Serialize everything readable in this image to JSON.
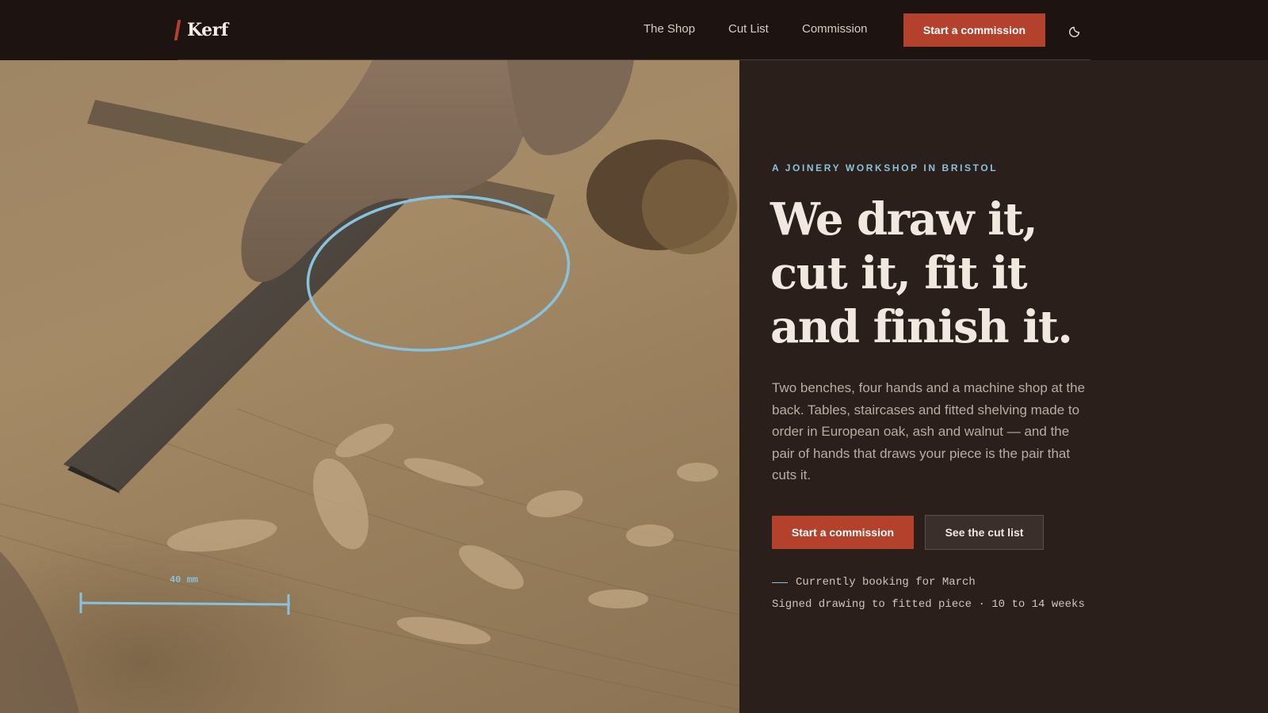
{
  "header": {
    "brand": "Kerf",
    "nav": [
      "The Shop",
      "Cut List",
      "Commission"
    ],
    "cta_label": "Start a commission",
    "theme_toggle_icon": "moon-icon"
  },
  "hero": {
    "annotation_measure_label": "40 mm",
    "eyebrow": "A JOINERY WORKSHOP IN BRISTOL",
    "headline": "We draw it, cut it, fit it and finish it.",
    "intro": "Two benches, four hands and a machine shop at the back. Tables, staircases and fitted shelving made to order in European oak, ash and walnut — and the pair of hands that draws your piece is the pair that cuts it.",
    "primary_cta": "Start a commission",
    "secondary_cta": "See the cut list",
    "booking_status": "Currently booking for March",
    "lead_time": "Signed drawing to fitted piece · 10 to 14 weeks"
  },
  "colors": {
    "accent": "#b3412c",
    "annotation": "#88c2dc",
    "header_bg": "#1d1411",
    "panel_bg": "#2a1f1a"
  }
}
